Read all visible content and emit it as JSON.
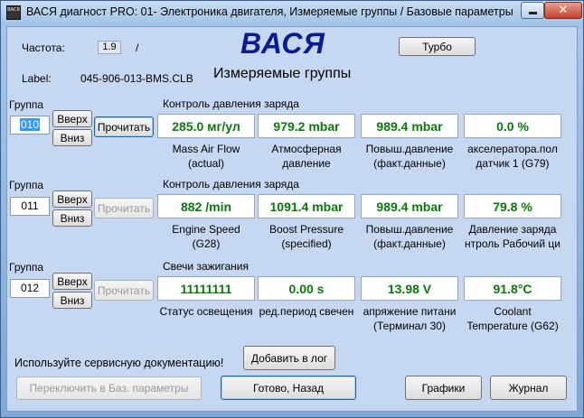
{
  "window": {
    "title": "ВАСЯ диагност PRO: 01- Электроника двигателя,  Измеряемые группы / Базовые параметры",
    "icon_text": "ВАСЯ",
    "close_glyph": "✕"
  },
  "header": {
    "freq_label": "Частота:",
    "freq_value": "1.9",
    "freq_slash": "/",
    "label_key": "Label:",
    "label_value": "045-906-013-BMS.CLB",
    "brand": "ВАСЯ",
    "subtitle": "Измеряемые группы",
    "turbo_button": "Турбо"
  },
  "groups": [
    {
      "label": "Группа",
      "number": "010",
      "up": "Вверх",
      "down": "Вниз",
      "read": "Прочитать",
      "section": "Контроль давления заряда",
      "values": [
        "285.0 мг/ул",
        "979.2 mbar",
        "989.4 mbar",
        "0.0 %"
      ],
      "labels": [
        [
          "Mass Air Flow",
          "(actual)"
        ],
        [
          "Атмосферная",
          "давление"
        ],
        [
          "Повыш.давление",
          "(факт.данные)"
        ],
        [
          "акселератора.пол",
          "датчик 1 (G79)"
        ]
      ]
    },
    {
      "label": "Группа",
      "number": "011",
      "up": "Вверх",
      "down": "Вниз",
      "read": "Прочитать",
      "section": "Контроль давления заряда",
      "values": [
        "882 /min",
        "1091.4 mbar",
        "989.4 mbar",
        "79.8 %"
      ],
      "labels": [
        [
          "Engine Speed",
          "(G28)"
        ],
        [
          "Boost Pressure",
          "(specified)"
        ],
        [
          "Повыш.давление",
          "(факт.данные)"
        ],
        [
          "Давление заряда",
          "нтроль Рабочий ци"
        ]
      ]
    },
    {
      "label": "Группа",
      "number": "012",
      "up": "Вверх",
      "down": "Вниз",
      "read": "Прочитать",
      "section": "Свечи зажигания",
      "values": [
        "11111111",
        "0.00 s",
        "13.98 V",
        "91.8°C"
      ],
      "labels": [
        [
          "Статус освещения",
          ""
        ],
        [
          "ред.период свечен",
          ""
        ],
        [
          "апряжение питани",
          "(Терминал 30)"
        ],
        [
          "Coolant",
          "Temperature (G62)"
        ]
      ]
    }
  ],
  "footer": {
    "doc_hint": "Используйте сервисную документацию!",
    "add_log": "Добавить в лог",
    "switch_basic": "Переключить в Баз. параметры",
    "done_back": "Готово, Назад",
    "graphs": "Графики",
    "journal": "Журнал"
  },
  "colors": {
    "brand": "#0a1d8f",
    "value_text": "#0a7a0a",
    "selection": "#3399ff"
  }
}
